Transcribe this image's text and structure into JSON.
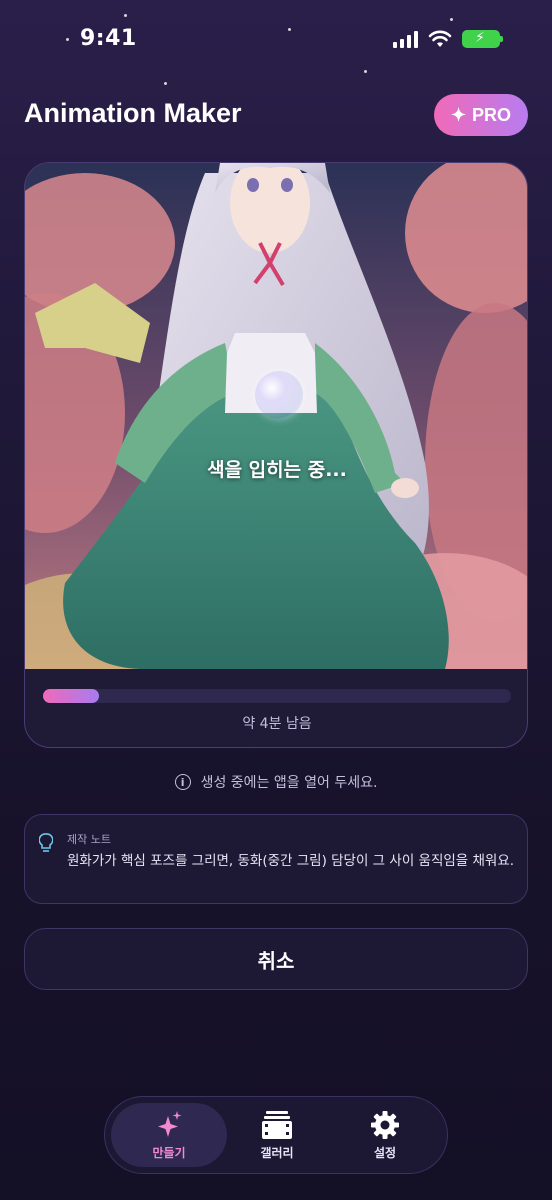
{
  "status_bar": {
    "time": "9:41"
  },
  "header": {
    "title": "Animation Maker",
    "pro_label": "PRO"
  },
  "generation": {
    "status_text": "색을 입히는 중...",
    "progress_fraction": 0.12,
    "time_left": "약 4분 남음"
  },
  "info": {
    "text": "생성 중에는 앱을 열어 두세요."
  },
  "note": {
    "title": "제작 노트",
    "body": "원화가가 핵심 포즈를 그리면, 동화(중간 그림) 담당이 그 사이 움직임을 채워요."
  },
  "cancel_label": "취소",
  "tabs": [
    {
      "label": "만들기",
      "icon": "sparkles-icon",
      "active": true
    },
    {
      "label": "갤러리",
      "icon": "film-icon",
      "active": false
    },
    {
      "label": "설정",
      "icon": "gear-icon",
      "active": false
    }
  ],
  "colors": {
    "accent_pink": "#f06ab8",
    "accent_purple": "#b77cf0",
    "battery_green": "#3fd24a"
  }
}
